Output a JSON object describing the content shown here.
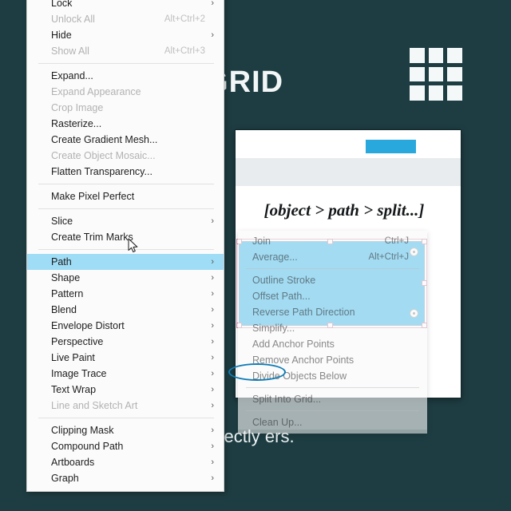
{
  "slide": {
    "title": "O GRID",
    "grid_icon": "grid-3x3-icon",
    "body_text": "ting layouts with perfectly ers."
  },
  "card": {
    "caption": "[object > path > split...]",
    "selection_color": "#3cb8ea",
    "toolbar_accent": "#29a8de"
  },
  "menu": {
    "highlight_color": "#9fdcf5",
    "items": [
      {
        "label": "Lock",
        "accel": "",
        "arrow": "›",
        "disabled": false,
        "selected": false,
        "sep_after": false
      },
      {
        "label": "Unlock All",
        "accel": "Alt+Ctrl+2",
        "arrow": "",
        "disabled": true,
        "selected": false,
        "sep_after": false
      },
      {
        "label": "Hide",
        "accel": "",
        "arrow": "›",
        "disabled": false,
        "selected": false,
        "sep_after": false
      },
      {
        "label": "Show All",
        "accel": "Alt+Ctrl+3",
        "arrow": "",
        "disabled": true,
        "selected": false,
        "sep_after": true
      },
      {
        "label": "Expand...",
        "accel": "",
        "arrow": "",
        "disabled": false,
        "selected": false,
        "sep_after": false
      },
      {
        "label": "Expand Appearance",
        "accel": "",
        "arrow": "",
        "disabled": true,
        "selected": false,
        "sep_after": false
      },
      {
        "label": "Crop Image",
        "accel": "",
        "arrow": "",
        "disabled": true,
        "selected": false,
        "sep_after": false
      },
      {
        "label": "Rasterize...",
        "accel": "",
        "arrow": "",
        "disabled": false,
        "selected": false,
        "sep_after": false
      },
      {
        "label": "Create Gradient Mesh...",
        "accel": "",
        "arrow": "",
        "disabled": false,
        "selected": false,
        "sep_after": false
      },
      {
        "label": "Create Object Mosaic...",
        "accel": "",
        "arrow": "",
        "disabled": true,
        "selected": false,
        "sep_after": false
      },
      {
        "label": "Flatten Transparency...",
        "accel": "",
        "arrow": "",
        "disabled": false,
        "selected": false,
        "sep_after": true
      },
      {
        "label": "Make Pixel Perfect",
        "accel": "",
        "arrow": "",
        "disabled": false,
        "selected": false,
        "sep_after": true
      },
      {
        "label": "Slice",
        "accel": "",
        "arrow": "›",
        "disabled": false,
        "selected": false,
        "sep_after": false
      },
      {
        "label": "Create Trim Marks",
        "accel": "",
        "arrow": "",
        "disabled": false,
        "selected": false,
        "sep_after": true
      },
      {
        "label": "Path",
        "accel": "",
        "arrow": "›",
        "disabled": false,
        "selected": true,
        "sep_after": false
      },
      {
        "label": "Shape",
        "accel": "",
        "arrow": "›",
        "disabled": false,
        "selected": false,
        "sep_after": false
      },
      {
        "label": "Pattern",
        "accel": "",
        "arrow": "›",
        "disabled": false,
        "selected": false,
        "sep_after": false
      },
      {
        "label": "Blend",
        "accel": "",
        "arrow": "›",
        "disabled": false,
        "selected": false,
        "sep_after": false
      },
      {
        "label": "Envelope Distort",
        "accel": "",
        "arrow": "›",
        "disabled": false,
        "selected": false,
        "sep_after": false
      },
      {
        "label": "Perspective",
        "accel": "",
        "arrow": "›",
        "disabled": false,
        "selected": false,
        "sep_after": false
      },
      {
        "label": "Live Paint",
        "accel": "",
        "arrow": "›",
        "disabled": false,
        "selected": false,
        "sep_after": false
      },
      {
        "label": "Image Trace",
        "accel": "",
        "arrow": "›",
        "disabled": false,
        "selected": false,
        "sep_after": false
      },
      {
        "label": "Text Wrap",
        "accel": "",
        "arrow": "›",
        "disabled": false,
        "selected": false,
        "sep_after": false
      },
      {
        "label": "Line and Sketch Art",
        "accel": "",
        "arrow": "›",
        "disabled": true,
        "selected": false,
        "sep_after": true
      },
      {
        "label": "Clipping Mask",
        "accel": "",
        "arrow": "›",
        "disabled": false,
        "selected": false,
        "sep_after": false
      },
      {
        "label": "Compound Path",
        "accel": "",
        "arrow": "›",
        "disabled": false,
        "selected": false,
        "sep_after": false
      },
      {
        "label": "Artboards",
        "accel": "",
        "arrow": "›",
        "disabled": false,
        "selected": false,
        "sep_after": false
      },
      {
        "label": "Graph",
        "accel": "",
        "arrow": "›",
        "disabled": false,
        "selected": false,
        "sep_after": false
      }
    ]
  },
  "submenu": {
    "items": [
      {
        "label": "Join",
        "accel": "Ctrl+J",
        "sep_after": false
      },
      {
        "label": "Average...",
        "accel": "Alt+Ctrl+J",
        "sep_after": true
      },
      {
        "label": "Outline Stroke",
        "accel": "",
        "sep_after": false
      },
      {
        "label": "Offset Path...",
        "accel": "",
        "sep_after": false
      },
      {
        "label": "Reverse Path Direction",
        "accel": "",
        "sep_after": false
      },
      {
        "label": "Simplify...",
        "accel": "",
        "sep_after": false
      },
      {
        "label": "Add Anchor Points",
        "accel": "",
        "sep_after": false
      },
      {
        "label": "Remove Anchor Points",
        "accel": "",
        "sep_after": false
      },
      {
        "label": "Divide Objects Below",
        "accel": "",
        "sep_after": true
      },
      {
        "label": "Split Into Grid...",
        "accel": "",
        "sep_after": true
      },
      {
        "label": "Clean Up...",
        "accel": "",
        "sep_after": false
      }
    ],
    "annotation": "ellipse-highlight-divide-objects-below"
  }
}
